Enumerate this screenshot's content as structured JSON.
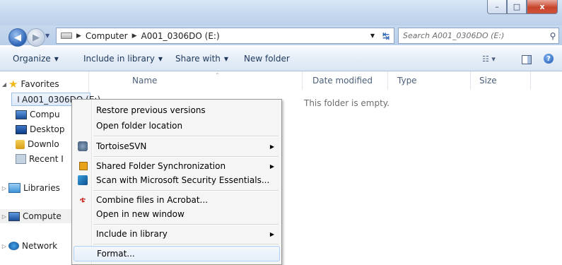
{
  "window": {
    "controls": {
      "minimize": "–",
      "maximize": "□",
      "close": "x"
    }
  },
  "address": {
    "back_icon": "◀",
    "forward_icon": "▶",
    "drop_icon": "▼",
    "breadcrumbs": [
      "Computer",
      "A001_0306DO (E:)"
    ],
    "separator": "▶",
    "refresh_icon": "↹",
    "search_placeholder": "Search A001_0306DO (E:)",
    "search_icon": "⚲"
  },
  "toolbar": {
    "organize": "Organize",
    "include_in_library": "Include in library",
    "share_with": "Share with",
    "new_folder": "New folder",
    "arrow": "▼",
    "view_icon": "☷ ▾",
    "help_icon": "?"
  },
  "nav": {
    "favorites": "Favorites",
    "drive": "A001_0306DO (E:)",
    "computer_sub": "Compu",
    "desktop": "Desktop",
    "downloads": "Downlo",
    "recent": "Recent I",
    "libraries": "Libraries",
    "computer": "Compute",
    "network": "Network",
    "expanded": "◢",
    "collapsed": "▷"
  },
  "columns": {
    "name": "Name",
    "date_modified": "Date modified",
    "type": "Type",
    "size": "Size"
  },
  "content": {
    "empty_message": "This folder is empty."
  },
  "context_menu": {
    "restore_previous_versions": "Restore previous versions",
    "open_folder_location": "Open folder location",
    "tortoise_svn": "TortoiseSVN",
    "shared_folder_sync": "Shared Folder Synchronization",
    "scan_security_essentials": "Scan with Microsoft Security Essentials...",
    "combine_acrobat": "Combine files in Acrobat...",
    "open_new_window": "Open in new window",
    "include_in_library": "Include in library",
    "format": "Format...",
    "submenu_arrow": "▶",
    "acrobat_icon": "ቴ"
  }
}
